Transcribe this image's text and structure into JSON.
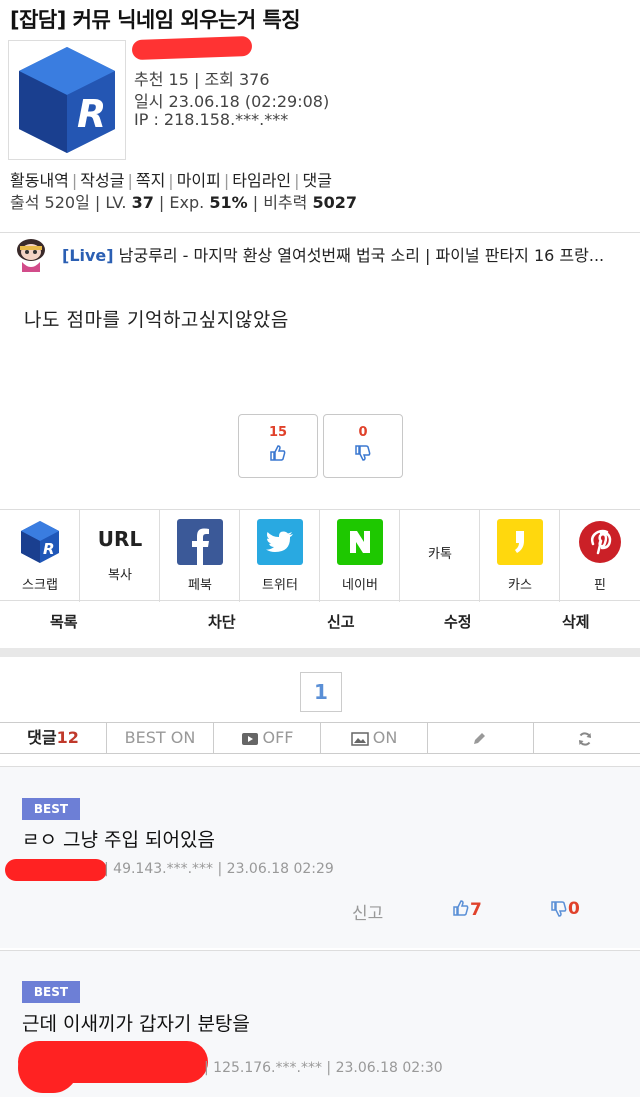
{
  "post": {
    "title": "[잡담] 커뮤 닉네임 외우는거 특징",
    "recommend": "추천 15 | 조회 376",
    "date": "일시 23.06.18 (02:29:08)",
    "ip": "IP : 218.158.***.***",
    "body": "나도 점마를 기억하고싶지않았음"
  },
  "author_links": [
    "활동내역",
    "작성글",
    "쪽지",
    "마이피",
    "타임라인",
    "댓글"
  ],
  "author_stats": {
    "attend_label": "출석 520일 |  LV.",
    "level": "37",
    "exp_label": " | Exp.",
    "exp": "51%",
    "power_label": " | 비추력",
    "power": "5027"
  },
  "live": {
    "tag": "[Live]",
    "text": " 남궁루리 - 마지막 환상 열여섯번째 법국 소리 | 파이널 판타지 16 프랑..."
  },
  "votes": {
    "up": "15",
    "down": "0"
  },
  "share": {
    "scrap": "스크랩",
    "url_big": "URL",
    "url_label": "복사",
    "facebook": "페북",
    "twitter": "트위터",
    "naver": "네이버",
    "katalk": "카톡",
    "kakaostory": "카스",
    "pinterest": "핀"
  },
  "actions": {
    "list": "목록",
    "block": "차단",
    "report": "신고",
    "edit": "수정",
    "delete": "삭제"
  },
  "pagination": {
    "current": "1"
  },
  "comment_tabs": {
    "comments_label": "댓글",
    "comments_count": "12",
    "best": "BEST ON",
    "video": "OFF",
    "image": "ON"
  },
  "comments": [
    {
      "badge": "BEST",
      "text": "ㄹㅇ 그냥 주입 되어있음",
      "meta": "| 49.143.***.*** | 23.06.18 02:29",
      "report": "신고",
      "up": "7",
      "down": "0"
    },
    {
      "badge": "BEST",
      "text": "근데 이새끼가 갑자기 분탕을",
      "meta": "| 125.176.***.*** | 23.06.18 02:30"
    }
  ],
  "colors": {
    "accent": "#5a8fd6",
    "best_badge": "#6d7fd6",
    "vote_count": "#e0422b",
    "redaction": "#ff2222"
  }
}
